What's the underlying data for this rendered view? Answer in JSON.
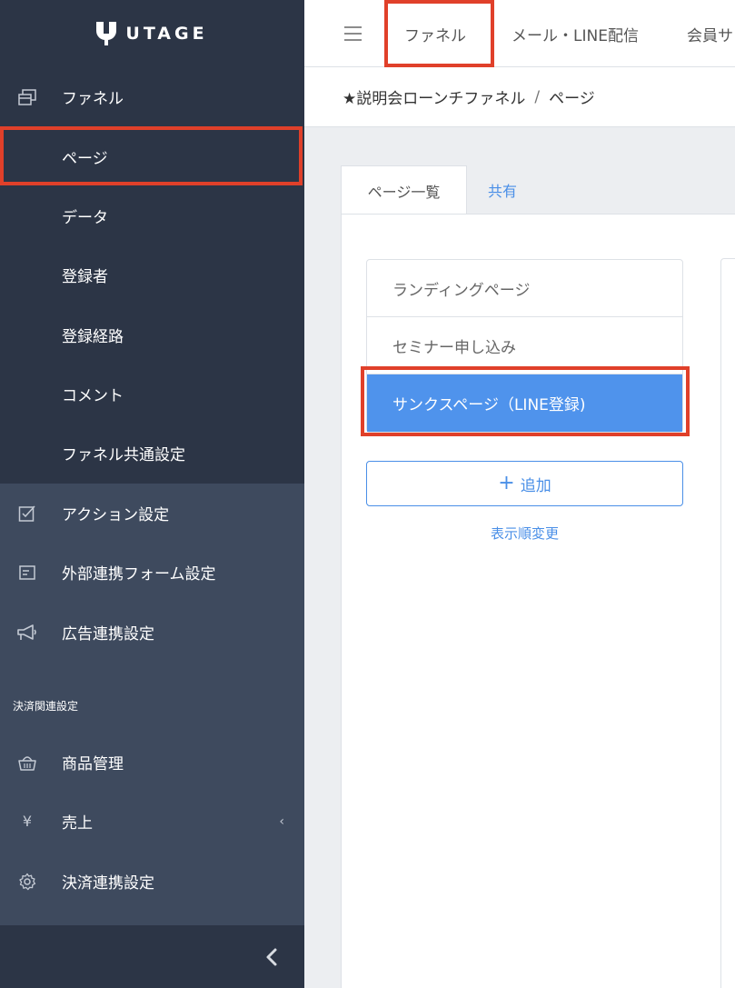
{
  "brand": {
    "name": "UTAGE",
    "logo_icon": "utage-logo"
  },
  "sidebar": {
    "funnel_header": {
      "label": "ファネル",
      "icon": "copy-icon"
    },
    "funnel_sub_items": [
      {
        "label": "ページ"
      },
      {
        "label": "データ"
      },
      {
        "label": "登録者"
      },
      {
        "label": "登録経路"
      },
      {
        "label": "コメント"
      },
      {
        "label": "ファネル共通設定"
      }
    ],
    "items": [
      {
        "label": "アクション設定",
        "icon": "checkbox-edit-icon"
      },
      {
        "label": "外部連携フォーム設定",
        "icon": "form-icon"
      },
      {
        "label": "広告連携設定",
        "icon": "megaphone-icon"
      }
    ],
    "payment_section": {
      "title": "決済関連設定",
      "items": [
        {
          "label": "商品管理",
          "icon": "basket-icon"
        },
        {
          "label": "売上",
          "icon": "yen-icon",
          "glyph": "¥"
        },
        {
          "label": "決済連携設定",
          "icon": "gear-icon"
        }
      ]
    }
  },
  "topbar": {
    "tabs": [
      {
        "label": "ファネル"
      },
      {
        "label": "メール・LINE配信"
      },
      {
        "label": "会員サ"
      }
    ]
  },
  "breadcrumb": {
    "funnel": "★説明会ローンチファネル",
    "separator": "/",
    "page": "ページ"
  },
  "content": {
    "tabs": [
      {
        "label": "ページ一覧"
      },
      {
        "label": "共有"
      }
    ],
    "pages": [
      {
        "label": "ランディングページ"
      },
      {
        "label": "セミナー申し込み"
      },
      {
        "label": "サンクスページ（LINE登録)"
      }
    ],
    "add_button": {
      "plus": "+",
      "label": "追加"
    },
    "reorder_link": "表示順変更"
  },
  "colors": {
    "sidebar_dark": "#2c3546",
    "sidebar": "#3e4a5e",
    "accent": "#4a8fe7",
    "active_item": "#4f93ec",
    "highlight_box": "#e0402a"
  }
}
